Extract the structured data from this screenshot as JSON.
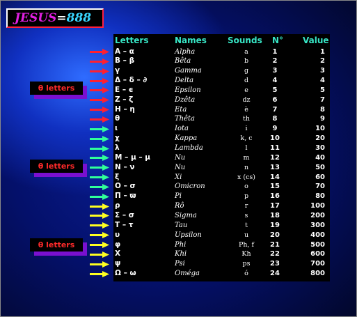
{
  "title": {
    "part1": "JESUS",
    "part2": "=",
    "part3": "888"
  },
  "tags": [
    {
      "label": "θ letters"
    },
    {
      "label": "θ letters"
    },
    {
      "label": "θ letters"
    }
  ],
  "colors": {
    "red": "#ff2030",
    "green": "#30ff9a",
    "yellow": "#ffff20",
    "header": "#37e6c6"
  },
  "table": {
    "headers": {
      "letters": "Letters",
      "names": "Names",
      "sounds": "Sounds",
      "n": "N°",
      "value": "Value"
    },
    "rows": [
      {
        "letter": "Α – α",
        "name": "Alpha",
        "sound": "a",
        "n": "1",
        "value": "1",
        "arrow": "red"
      },
      {
        "letter": "Β – β",
        "name": "Bêta",
        "sound": "b",
        "n": "2",
        "value": "2",
        "arrow": "red"
      },
      {
        "letter": "γ",
        "name": "Gamma",
        "sound": "g",
        "n": "3",
        "value": "3",
        "arrow": "red"
      },
      {
        "letter": "Δ – δ – ∂",
        "name": "Delta",
        "sound": "d",
        "n": "4",
        "value": "4",
        "arrow": "red"
      },
      {
        "letter": "Ε – ϵ",
        "name": "Epsilon",
        "sound": "e",
        "n": "5",
        "value": "5",
        "arrow": "red"
      },
      {
        "letter": "Ζ – ζ",
        "name": "Dzêta",
        "sound": "dz",
        "n": "6",
        "value": "7",
        "arrow": "red"
      },
      {
        "letter": "Η – η",
        "name": "Eta",
        "sound": "è",
        "n": "7",
        "value": "8",
        "arrow": "red"
      },
      {
        "letter": "θ",
        "name": "Thêta",
        "sound": "th",
        "n": "8",
        "value": "9",
        "arrow": "red"
      },
      {
        "letter": "ι",
        "name": "Iota",
        "sound": "i",
        "n": "9",
        "value": "10",
        "arrow": "green"
      },
      {
        "letter": "χ",
        "name": "Kappa",
        "sound": "k, c",
        "n": "10",
        "value": "20",
        "arrow": "green"
      },
      {
        "letter": "λ",
        "name": "Lambda",
        "sound": "l",
        "n": "11",
        "value": "30",
        "arrow": "green"
      },
      {
        "letter": "Μ – μ – µ",
        "name": "Nu",
        "sound": "m",
        "n": "12",
        "value": "40",
        "arrow": "green"
      },
      {
        "letter": "Ν – ν",
        "name": "Nu",
        "sound": "n",
        "n": "13",
        "value": "50",
        "arrow": "green"
      },
      {
        "letter": "ξ",
        "name": "Xi",
        "sound": "x (cs)",
        "n": "14",
        "value": "60",
        "arrow": "green"
      },
      {
        "letter": "Ο – σ",
        "name": "Omicron",
        "sound": "o",
        "n": "15",
        "value": "70",
        "arrow": "green"
      },
      {
        "letter": "Π – ϖ",
        "name": "Pi",
        "sound": "p",
        "n": "16",
        "value": "80",
        "arrow": "green"
      },
      {
        "letter": "ρ",
        "name": "Rô",
        "sound": "r",
        "n": "17",
        "value": "100",
        "arrow": "yellow"
      },
      {
        "letter": "Σ – σ",
        "name": "Sigma",
        "sound": "s",
        "n": "18",
        "value": "200",
        "arrow": "yellow"
      },
      {
        "letter": "Τ – τ",
        "name": "Tau",
        "sound": "t",
        "n": "19",
        "value": "300",
        "arrow": "yellow"
      },
      {
        "letter": "υ",
        "name": "Upsilon",
        "sound": "u",
        "n": "20",
        "value": "400",
        "arrow": "yellow"
      },
      {
        "letter": "φ",
        "name": "Phi",
        "sound": "Ph, f",
        "n": "21",
        "value": "500",
        "arrow": "yellow"
      },
      {
        "letter": "Χ",
        "name": "Khi",
        "sound": "Kh",
        "n": "22",
        "value": "600",
        "arrow": "yellow"
      },
      {
        "letter": "ψ",
        "name": "Psi",
        "sound": "ps",
        "n": "23",
        "value": "700",
        "arrow": "yellow"
      },
      {
        "letter": "Ω – ω",
        "name": "Oméga",
        "sound": "ó",
        "n": "24",
        "value": "800",
        "arrow": "yellow"
      }
    ]
  }
}
